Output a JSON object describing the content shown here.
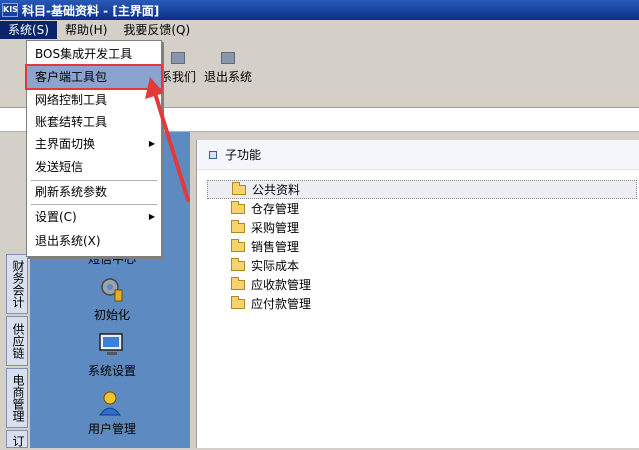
{
  "window": {
    "icon_text": "KIS",
    "title": "科目-基础资料 - [主界面]"
  },
  "menubar": [
    "系统(S)",
    "帮助(H)",
    "我要反馈(Q)"
  ],
  "toolbar": {
    "contact_label": "系我们",
    "exit_label": "退出系统"
  },
  "vertical_tabs": [
    "财务会计",
    "供应链",
    "电商管理",
    "订"
  ],
  "launchers": [
    "短信中心",
    "初始化",
    "系统设置",
    "用户管理"
  ],
  "dropdown": {
    "items": [
      "BOS集成开发工具",
      "客户端工具包",
      "网络控制工具",
      "账套结转工具",
      "主界面切换",
      "发送短信",
      "刷新系统参数",
      "设置(C)",
      "退出系统(X)"
    ],
    "highlighted": "客户端工具包"
  },
  "right_panel": {
    "header": "子功能",
    "tree": {
      "root": "公共资料",
      "children": [
        "仓存管理",
        "采购管理",
        "销售管理",
        "实际成本",
        "应收款管理",
        "应付款管理"
      ]
    }
  },
  "colors": {
    "highlight": "#8aa4cf",
    "annotation": "#e23a3a",
    "titlebar": "#0a2f8a"
  }
}
